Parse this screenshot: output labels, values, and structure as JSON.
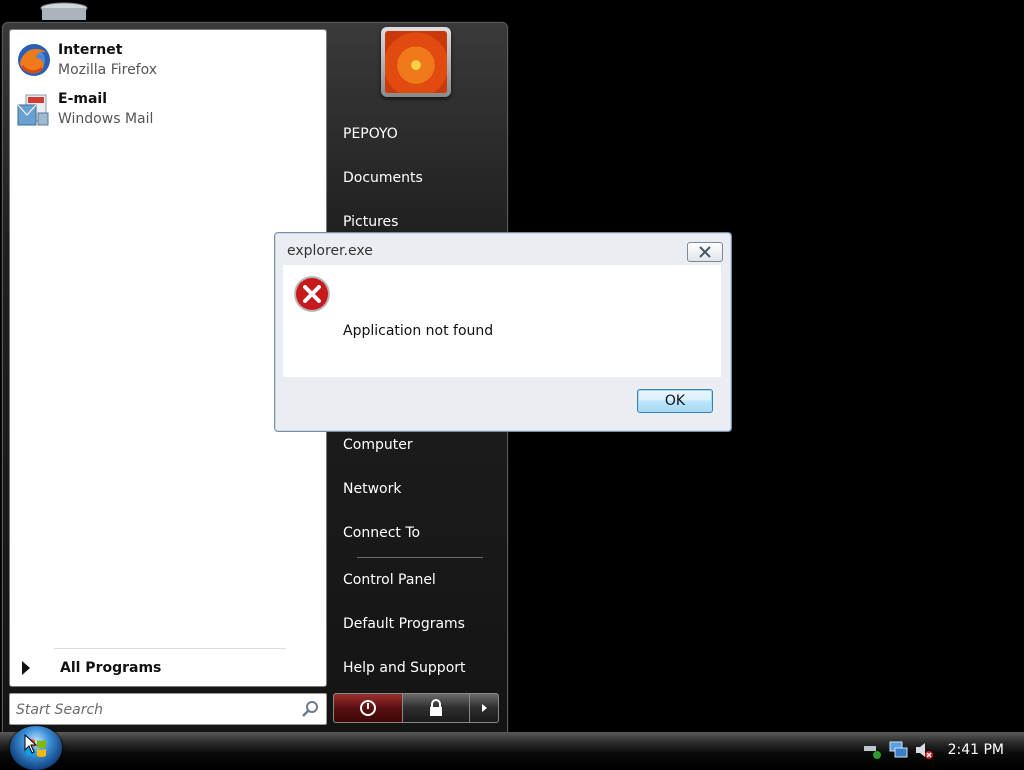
{
  "pinned": [
    {
      "title": "Internet",
      "subtitle": "Mozilla Firefox",
      "icon": "firefox-icon"
    },
    {
      "title": "E-mail",
      "subtitle": "Windows Mail",
      "icon": "mail-icon"
    }
  ],
  "all_programs_label": "All Programs",
  "search": {
    "placeholder": "Start Search"
  },
  "right_links": {
    "user": "PEPOYO",
    "documents": "Documents",
    "pictures": "Pictures",
    "computer": "Computer",
    "network": "Network",
    "connect_to": "Connect To",
    "control_panel": "Control Panel",
    "default_programs": "Default Programs",
    "help": "Help and Support"
  },
  "dialog": {
    "title": "explorer.exe",
    "message": "Application not found",
    "ok_label": "OK"
  },
  "taskbar": {
    "clock": "2:41 PM"
  },
  "colors": {
    "error_red": "#c8191c",
    "accent_blue": "#3c7fb1"
  }
}
